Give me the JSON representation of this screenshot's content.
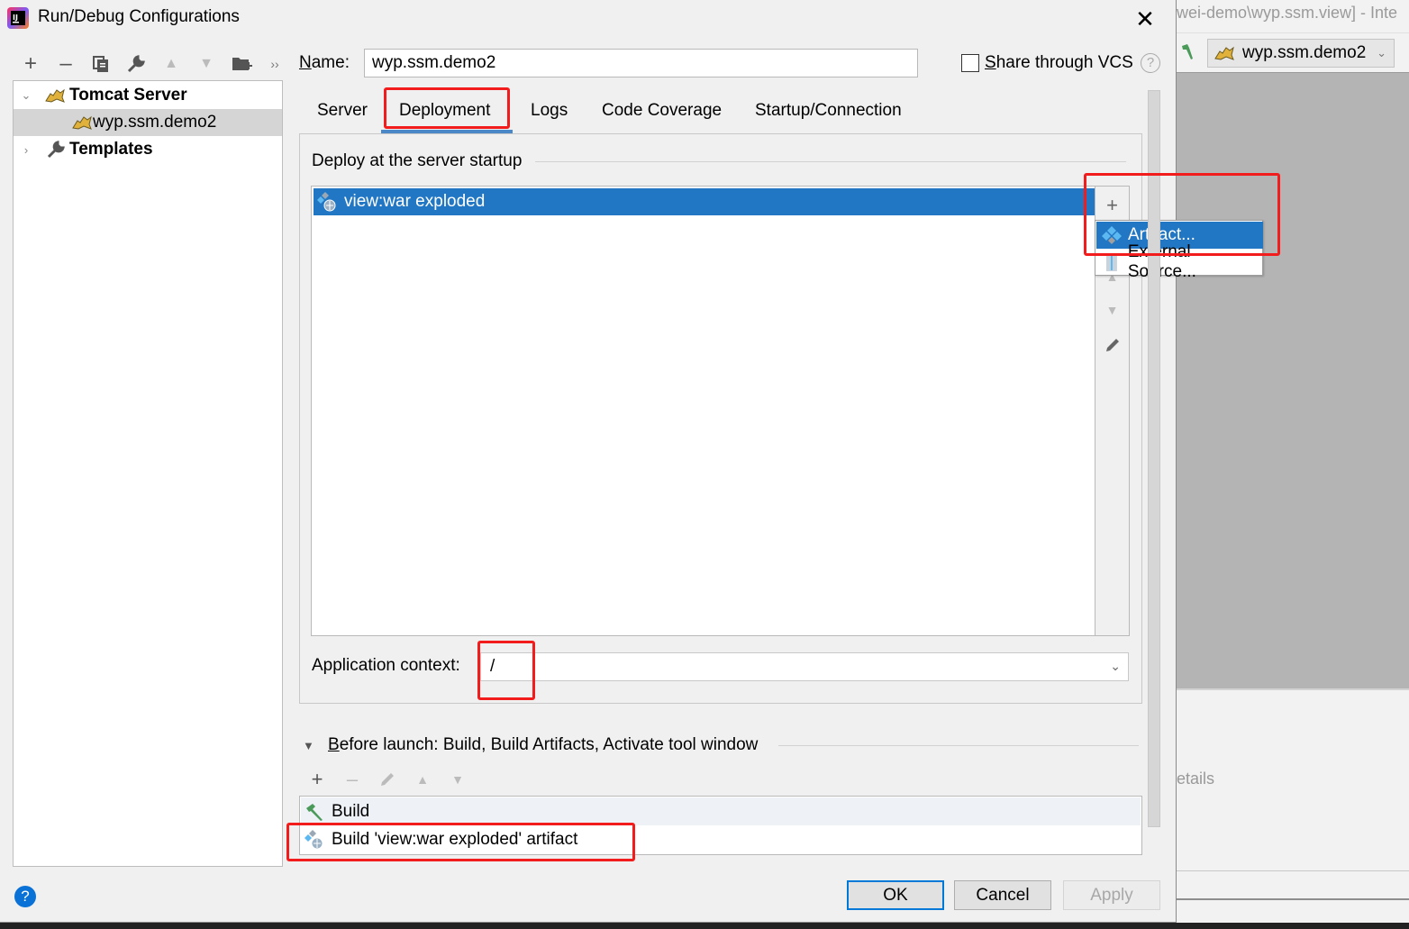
{
  "dialog": {
    "title": "Run/Debug Configurations",
    "close_icon": "close-icon",
    "app_icon": "intellij-icon"
  },
  "toolbar": {
    "icons": [
      "add-icon",
      "remove-icon",
      "copy-icon",
      "wrench-icon",
      "move-up-icon",
      "move-down-icon",
      "new-folder-icon",
      "more-icon"
    ]
  },
  "tree": {
    "items": [
      {
        "label": "Tomcat Server",
        "icon": "tomcat-icon",
        "expanded": true,
        "bold": true
      },
      {
        "label": "wyp.ssm.demo2",
        "icon": "tomcat-icon",
        "selected": true
      },
      {
        "label": "Templates",
        "icon": "wrench-icon",
        "expanded": false,
        "bold": true
      }
    ]
  },
  "name": {
    "label": "Name:",
    "mnemonic": "N",
    "label_rest": "ame:",
    "value": "wyp.ssm.demo2"
  },
  "share": {
    "mnemonic": "S",
    "label_rest": "hare through VCS",
    "checked": false,
    "help": "?"
  },
  "tabs": [
    {
      "label": "Server"
    },
    {
      "label": "Deployment",
      "active": true
    },
    {
      "label": "Logs"
    },
    {
      "label": "Code Coverage"
    },
    {
      "label": "Startup/Connection"
    }
  ],
  "deployment": {
    "section_title": "Deploy at the server startup",
    "items": [
      {
        "label": "view:war exploded",
        "selected": true,
        "icon": "artifact-icon"
      }
    ],
    "side_buttons": [
      "add-icon",
      "move-up-icon",
      "move-down-icon",
      "edit-icon"
    ],
    "popup": [
      {
        "label": "Artifact...",
        "icon": "artifact-icon",
        "highlighted": true
      },
      {
        "label": "External Source...",
        "icon": "archive-icon"
      }
    ],
    "app_context_label": "Application context:",
    "app_context_value": "/"
  },
  "before_launch": {
    "mnemonic": "B",
    "title_rest": "efore launch: Build, Build Artifacts, Activate tool window",
    "toolbar": [
      "add-icon",
      "remove-icon",
      "edit-icon",
      "move-up-icon",
      "move-down-icon"
    ],
    "items": [
      {
        "label": "Build",
        "icon": "build-hammer-icon"
      },
      {
        "label": "Build 'view:war exploded' artifact",
        "icon": "artifact-icon"
      }
    ]
  },
  "buttons": {
    "ok": "OK",
    "cancel": "Cancel",
    "apply": "Apply",
    "help": "?"
  },
  "background_ide": {
    "title_fragment": "wei-demo\\wyp.ssm.view] - Inte",
    "run_config": "wyp.ssm.demo2",
    "details_fragment": "etails"
  },
  "colors": {
    "selection": "#2177c4",
    "tab_underline": "#4a88c7",
    "annotation": "#f31c1c",
    "default_button_border": "#0078d7"
  }
}
